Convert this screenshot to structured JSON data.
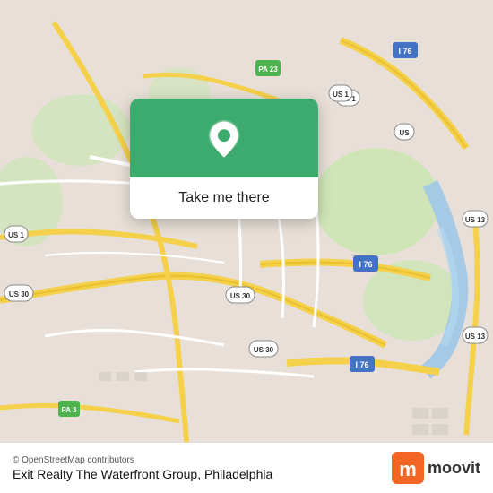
{
  "map": {
    "bg_color": "#e8e0d8",
    "road_color": "#ffffff",
    "highway_color": "#f5d04a",
    "green_area_color": "#c8e6b0"
  },
  "popup": {
    "bg_color": "#3dab6e",
    "button_label": "Take me there",
    "pin_icon": "location-pin"
  },
  "bottom_bar": {
    "copyright": "© OpenStreetMap contributors",
    "location_name": "Exit Realty The Waterfront Group, Philadelphia",
    "moovit_label": "moovit"
  }
}
